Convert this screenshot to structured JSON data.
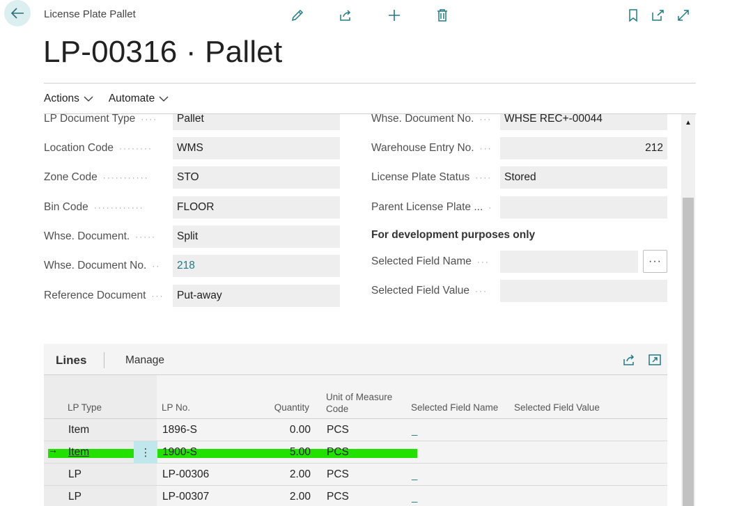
{
  "header": {
    "breadcrumb": "License Plate Pallet",
    "title": "LP-00316 · Pallet"
  },
  "actionbar": {
    "actions": "Actions",
    "automate": "Automate"
  },
  "fields_left": [
    {
      "label": "LP Document Type",
      "value": "Pallet"
    },
    {
      "label": "Location Code",
      "value": "WMS"
    },
    {
      "label": "Zone Code",
      "value": "STO"
    },
    {
      "label": "Bin Code",
      "value": "FLOOR"
    },
    {
      "label": "Whse. Document.",
      "value": "Split"
    },
    {
      "label": "Whse. Document No.",
      "value": "218"
    },
    {
      "label": "Reference Document",
      "value": "Put-away"
    }
  ],
  "fields_right": [
    {
      "label": "Whse. Document No.",
      "value": "WHSE REC+-00044"
    },
    {
      "label": "Warehouse Entry No.",
      "value": "212"
    },
    {
      "label": "License Plate Status",
      "value": "Stored"
    },
    {
      "label": "Parent License Plate ...",
      "value": ""
    }
  ],
  "dev": {
    "heading": "For development purposes only",
    "field_name_label": "Selected Field Name",
    "field_name_value": "",
    "field_value_label": "Selected Field Value",
    "field_value_value": "",
    "ellipsis": "···"
  },
  "lines": {
    "title": "Lines",
    "manage": "Manage",
    "columns": {
      "lp_type": "LP Type",
      "lp_no": "LP No.",
      "quantity": "Quantity",
      "uom_1": "Unit of Measure",
      "uom_2": "Code",
      "sel_name": "Selected Field Name",
      "sel_value": "Selected Field Value"
    },
    "rows": [
      {
        "lp_type": "Item",
        "lp_no": "1896-S",
        "quantity": "0.00",
        "uom": "PCS",
        "sel_name": "_"
      },
      {
        "lp_type": "Item",
        "lp_no": "1900-S",
        "quantity": "5.00",
        "uom": "PCS",
        "sel_name": ""
      },
      {
        "lp_type": "LP",
        "lp_no": "LP-00306",
        "quantity": "2.00",
        "uom": "PCS",
        "sel_name": "_"
      },
      {
        "lp_type": "LP",
        "lp_no": "LP-00307",
        "quantity": "2.00",
        "uom": "PCS",
        "sel_name": "_"
      }
    ],
    "highlight_color": "#22e000"
  },
  "colors": {
    "accent": "#1e7b84",
    "back_button_bg": "#dbeef0"
  },
  "icons": [
    "back-arrow-icon",
    "edit-icon",
    "share-icon",
    "add-icon",
    "delete-icon",
    "bookmark-icon",
    "open-new-icon",
    "expand-icon",
    "chevron-down-icon",
    "row-arrow-icon",
    "scroll-up-icon"
  ]
}
